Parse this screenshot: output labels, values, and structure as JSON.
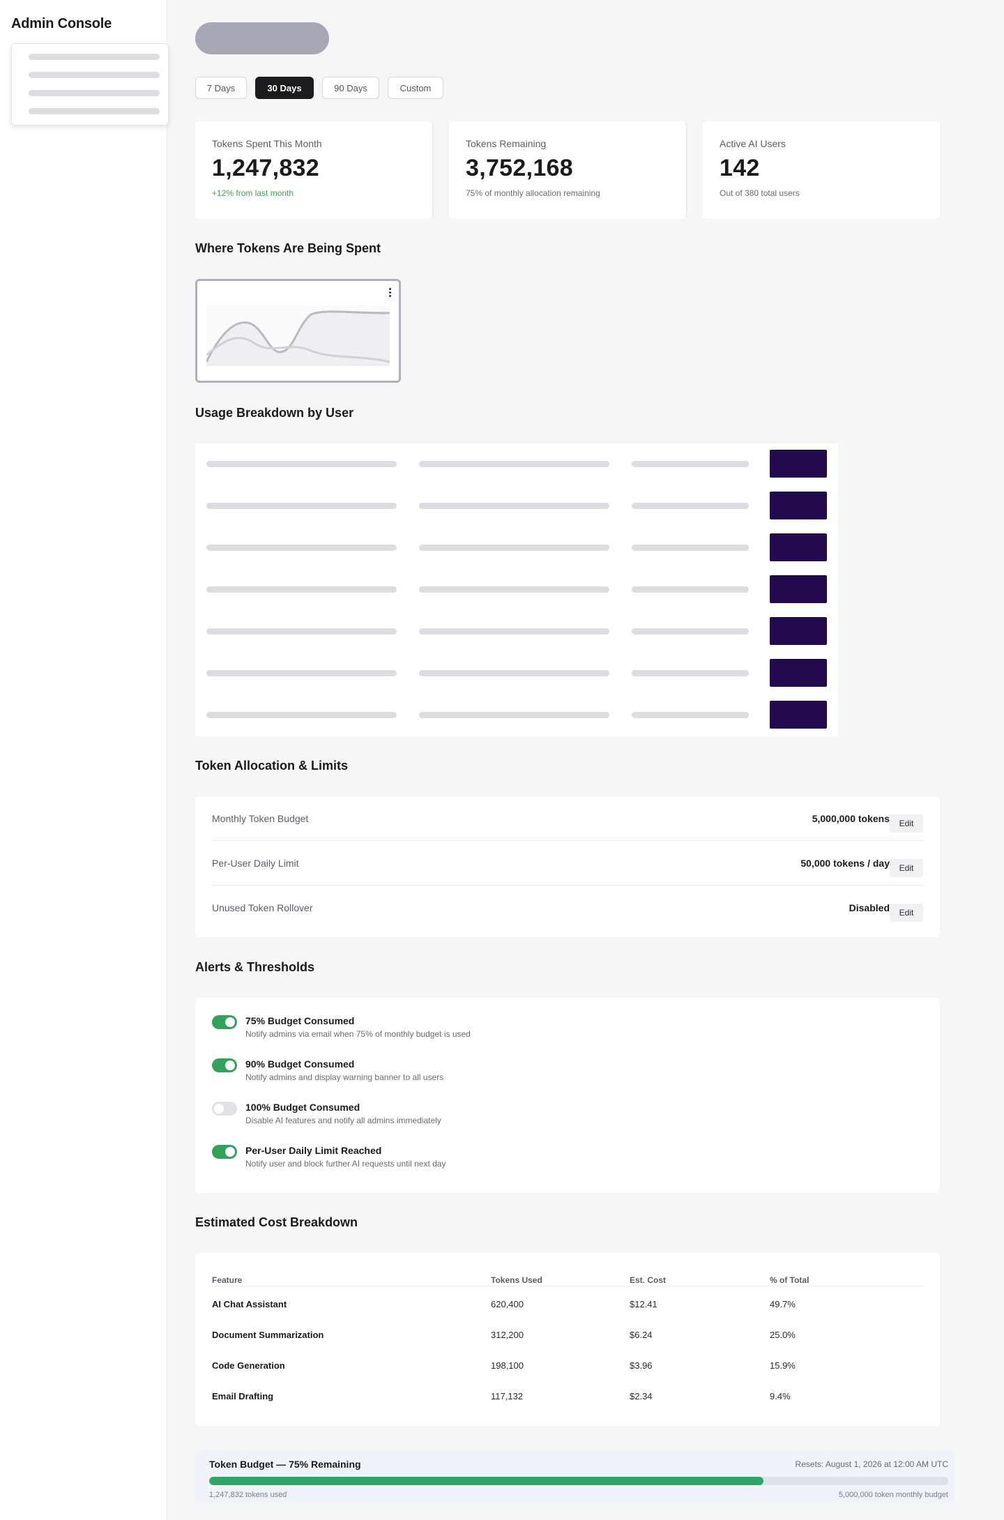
{
  "sidebar": {
    "brand": "Admin Console"
  },
  "range_tabs": [
    {
      "label": "7 Days",
      "active": false
    },
    {
      "label": "30 Days",
      "active": true
    },
    {
      "label": "90 Days",
      "active": false
    },
    {
      "label": "Custom",
      "active": false
    }
  ],
  "stats": [
    {
      "label": "Tokens Spent This Month",
      "value": "1,247,832",
      "sub": "+12% from last month"
    },
    {
      "label": "Tokens Remaining",
      "value": "3,752,168",
      "sub": "75% of monthly allocation remaining"
    },
    {
      "label": "Active AI Users",
      "value": "142",
      "sub": "Out of 380 total users"
    }
  ],
  "sections": {
    "spend": "Where Tokens Are Being Spent",
    "usage": "Usage Breakdown by User",
    "allocation": "Token Allocation & Limits",
    "alerts": "Alerts & Thresholds",
    "cost": "Estimated Cost Breakdown"
  },
  "allocation": [
    {
      "label": "Monthly Token Budget",
      "value": "5,000,000 tokens",
      "action": "Edit"
    },
    {
      "label": "Per-User Daily Limit",
      "value": "50,000 tokens / day",
      "action": "Edit"
    },
    {
      "label": "Unused Token Rollover",
      "value": "Disabled",
      "action": "Edit"
    }
  ],
  "alerts": [
    {
      "title": "75% Budget Consumed",
      "desc": "Notify admins via email when 75% of monthly budget is used",
      "enabled": true
    },
    {
      "title": "90% Budget Consumed",
      "desc": "Notify admins and display warning banner to all users",
      "enabled": true
    },
    {
      "title": "100% Budget Consumed",
      "desc": "Disable AI features and notify all admins immediately",
      "enabled": false
    },
    {
      "title": "Per-User Daily Limit Reached",
      "desc": "Notify user and block further AI requests until next day",
      "enabled": true
    }
  ],
  "cost_table": {
    "headers": [
      "Feature",
      "Tokens Used",
      "Est. Cost",
      "% of Total"
    ],
    "rows": [
      [
        "AI Chat Assistant",
        "620,400",
        "$12.41",
        "49.7%"
      ],
      [
        "Document Summarization",
        "312,200",
        "$6.24",
        "25.0%"
      ],
      [
        "Code Generation",
        "198,100",
        "$3.96",
        "15.9%"
      ],
      [
        "Email Drafting",
        "117,132",
        "$2.34",
        "9.4%"
      ]
    ]
  },
  "budget": {
    "title": "Token Budget — 75% Remaining",
    "reset": "Resets: August 1, 2026 at 12:00 AM UTC",
    "used_label": "1,247,832 tokens used",
    "total_label": "5,000,000 token monthly budget",
    "used_fraction": 0.75
  },
  "colors": {
    "accent_dark": "#1c1c1e",
    "row_button": "#23094e",
    "toggle_on": "#31a25a",
    "progress": "#2ea66a",
    "positive_text": "#3aa657"
  }
}
